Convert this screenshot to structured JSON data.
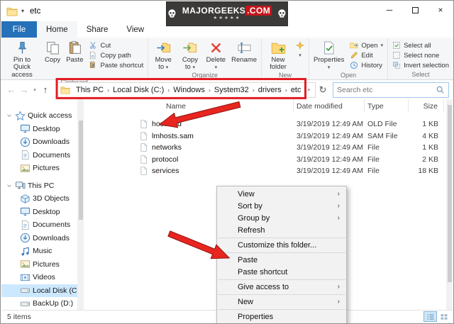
{
  "glyphs": {
    "dropdown": "▾",
    "chevron": "›",
    "back": "←",
    "forward": "→",
    "up": "↑",
    "refresh": "↻",
    "minimize": "─",
    "close": "×"
  },
  "window": {
    "title": "etc"
  },
  "watermark": {
    "name": "MAJORGEEKS",
    "tld": ".COM",
    "stars": "★★★★★"
  },
  "tabs": {
    "file": "File",
    "items": [
      "Home",
      "Share",
      "View"
    ],
    "active": "Home"
  },
  "ribbon": {
    "clipboard": {
      "label": "Clipboard",
      "pin": "Pin to Quick access",
      "copy": "Copy",
      "paste": "Paste",
      "cut": "Cut",
      "copy_path": "Copy path",
      "paste_shortcut": "Paste shortcut"
    },
    "organize": {
      "label": "Organize",
      "move_to": "Move to",
      "copy_to": "Copy to",
      "delete": "Delete",
      "rename": "Rename"
    },
    "new_group": {
      "label": "New",
      "new_folder": "New folder"
    },
    "open_group": {
      "label": "Open",
      "properties": "Properties",
      "open": "Open",
      "edit": "Edit",
      "history": "History"
    },
    "select_group": {
      "label": "Select",
      "select_all": "Select all",
      "select_none": "Select none",
      "invert": "Invert selection"
    }
  },
  "addressbar": {
    "breadcrumb": [
      "This PC",
      "Local Disk (C:)",
      "Windows",
      "System32",
      "drivers",
      "etc"
    ],
    "search_placeholder": "Search etc"
  },
  "filelist": {
    "columns": [
      "Name",
      "Date modified",
      "Type",
      "Size"
    ],
    "rows": [
      {
        "name": "hosts.old",
        "date": "3/19/2019 12:49 AM",
        "type": "OLD File",
        "size": "1 KB"
      },
      {
        "name": "lmhosts.sam",
        "date": "3/19/2019 12:49 AM",
        "type": "SAM File",
        "size": "4 KB"
      },
      {
        "name": "networks",
        "date": "3/19/2019 12:49 AM",
        "type": "File",
        "size": "1 KB"
      },
      {
        "name": "protocol",
        "date": "3/19/2019 12:49 AM",
        "type": "File",
        "size": "2 KB"
      },
      {
        "name": "services",
        "date": "3/19/2019 12:49 AM",
        "type": "File",
        "size": "18 KB"
      }
    ]
  },
  "sidebar": {
    "items": [
      {
        "label": "Quick access",
        "icon": "star",
        "level": 0,
        "chevron": true
      },
      {
        "label": "Desktop",
        "icon": "monitor",
        "level": 1
      },
      {
        "label": "Downloads",
        "icon": "download",
        "level": 1
      },
      {
        "label": "Documents",
        "icon": "doc",
        "level": 1
      },
      {
        "label": "Pictures",
        "icon": "picture",
        "level": 1
      },
      {
        "label": "This PC",
        "icon": "pc",
        "level": 0,
        "chevron": true,
        "gap": true
      },
      {
        "label": "3D Objects",
        "icon": "cube",
        "level": 1
      },
      {
        "label": "Desktop",
        "icon": "monitor",
        "level": 1
      },
      {
        "label": "Documents",
        "icon": "doc",
        "level": 1
      },
      {
        "label": "Downloads",
        "icon": "download",
        "level": 1
      },
      {
        "label": "Music",
        "icon": "music",
        "level": 1
      },
      {
        "label": "Pictures",
        "icon": "picture",
        "level": 1
      },
      {
        "label": "Videos",
        "icon": "video",
        "level": 1
      },
      {
        "label": "Local Disk (C:)",
        "icon": "drive",
        "level": 1,
        "selected": true
      },
      {
        "label": "BackUp (D:)",
        "icon": "drive",
        "level": 1
      }
    ]
  },
  "context_menu": {
    "items": [
      {
        "label": "View",
        "submenu": true
      },
      {
        "label": "Sort by",
        "submenu": true
      },
      {
        "label": "Group by",
        "submenu": true
      },
      {
        "label": "Refresh"
      },
      {
        "separator": true
      },
      {
        "label": "Customize this folder..."
      },
      {
        "separator": true
      },
      {
        "label": "Paste"
      },
      {
        "label": "Paste shortcut"
      },
      {
        "separator": true
      },
      {
        "label": "Give access to",
        "submenu": true
      },
      {
        "separator": true
      },
      {
        "label": "New",
        "submenu": true
      },
      {
        "separator": true
      },
      {
        "label": "Properties"
      }
    ]
  },
  "statusbar": {
    "items_count": "5 items"
  },
  "colors": {
    "accent": "#2470b9",
    "annotation": "#e8251f",
    "selection": "#cce8ff"
  }
}
